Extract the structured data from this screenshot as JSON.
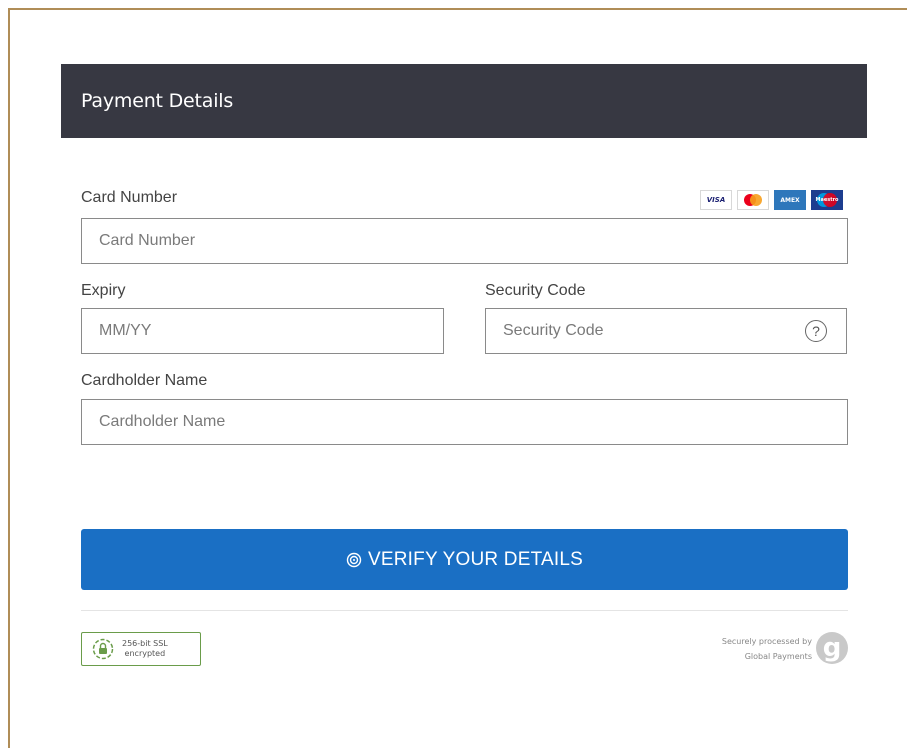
{
  "header": {
    "title": "Payment Details"
  },
  "fields": {
    "card_number": {
      "label": "Card Number",
      "placeholder": "Card Number",
      "value": ""
    },
    "expiry": {
      "label": "Expiry",
      "placeholder": "MM/YY",
      "value": ""
    },
    "security_code": {
      "label": "Security Code",
      "placeholder": "Security Code",
      "value": "",
      "help": "?"
    },
    "cardholder_name": {
      "label": "Cardholder Name",
      "placeholder": "Cardholder Name",
      "value": ""
    }
  },
  "card_logos": [
    {
      "name": "visa-icon",
      "text": "VISA",
      "color": "#1a1f71"
    },
    {
      "name": "mastercard-icon",
      "text": "",
      "color": "#eb001b"
    },
    {
      "name": "amex-icon",
      "text": "AMEX",
      "color": "#2e77bb"
    },
    {
      "name": "maestro-icon",
      "text": "Maestro",
      "color": "#0099df"
    }
  ],
  "verify_button": {
    "label": "VERIFY YOUR DETAILS",
    "icon": "fingerprint-icon",
    "color": "#1a6fc4"
  },
  "ssl_badge": {
    "line1": "256-bit SSL",
    "line2": "encrypted",
    "icon": "lock-icon",
    "color": "#6a9c4a"
  },
  "secure_notice": {
    "line1": "Securely processed by",
    "line2": "Global Payments",
    "logo_letter": "g"
  },
  "colors": {
    "header_bg": "#373842",
    "frame_border": "#b08d57"
  }
}
